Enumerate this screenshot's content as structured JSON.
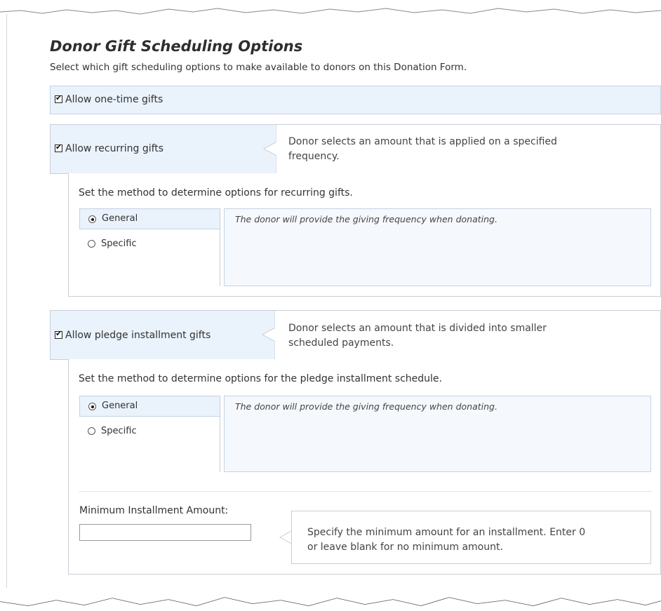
{
  "header": {
    "title": "Donor Gift Scheduling Options",
    "subtitle": "Select which gift scheduling options to make available to donors on this Donation Form."
  },
  "one_time": {
    "label": "Allow one-time gifts",
    "checked": true
  },
  "recurring": {
    "label": "Allow recurring gifts",
    "checked": true,
    "description_line1": "Donor selects an amount that is applied on a specified",
    "description_line2": "frequency.",
    "intro": "Set the method to determine options for recurring gifts.",
    "options": [
      {
        "label": "General",
        "selected": true
      },
      {
        "label": "Specific",
        "selected": false
      }
    ],
    "detail": "The donor will provide the giving frequency when donating."
  },
  "pledge": {
    "label": "Allow pledge installment gifts",
    "checked": true,
    "description_line1": "Donor selects an amount that is divided into smaller",
    "description_line2": "scheduled payments.",
    "intro": "Set the method to determine options for the pledge installment schedule.",
    "options": [
      {
        "label": "General",
        "selected": true
      },
      {
        "label": "Specific",
        "selected": false
      }
    ],
    "detail": "The donor will provide the giving frequency when donating.",
    "minimum": {
      "label": "Minimum Installment Amount:",
      "value": "",
      "hint_line1": "Specify the minimum amount for an installment. Enter 0",
      "hint_line2": "or leave blank for no minimum amount."
    }
  },
  "colors": {
    "highlight_bg": "#eaf2fb",
    "border": "#c4d3e4",
    "title": "#2e2e2e"
  }
}
